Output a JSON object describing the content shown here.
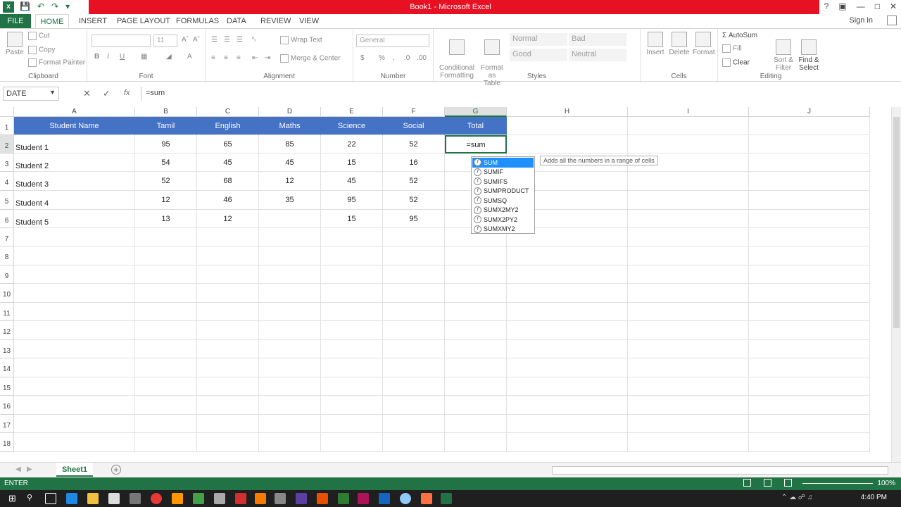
{
  "window": {
    "title": "Book1 -  Microsoft Excel",
    "controls": [
      "?",
      "▣",
      "—",
      "□",
      "✕"
    ]
  },
  "ribbon_tabs": [
    "FILE",
    "HOME",
    "INSERT",
    "PAGE LAYOUT",
    "FORMULAS",
    "DATA",
    "REVIEW",
    "VIEW"
  ],
  "signin": "Sign in",
  "ribbon": {
    "clipboard": {
      "paste": "Paste",
      "cut": "Cut",
      "copy": "Copy",
      "format_painter": "Format Painter",
      "label": "Clipboard"
    },
    "font": {
      "name": "",
      "size": "11",
      "label": "Font",
      "bold": "B",
      "italic": "I",
      "underline": "U",
      "font_color": "A"
    },
    "alignment": {
      "wrap": "Wrap Text",
      "merge": "Merge & Center",
      "label": "Alignment"
    },
    "number": {
      "format": "General",
      "currency": "$",
      "percent": "%",
      "label": "Number"
    },
    "styles": {
      "conditional": "Conditional\nFormatting",
      "format_table": "Format as\nTable",
      "normal": "Normal",
      "bad": "Bad",
      "good": "Good",
      "neutral": "Neutral",
      "label": "Styles"
    },
    "cells": {
      "insert": "Insert",
      "delete": "Delete",
      "format": "Format",
      "label": "Cells"
    },
    "editing": {
      "autosum": "AutoSum",
      "fill": "Fill",
      "clear": "Clear",
      "sort": "Sort &\nFilter",
      "find": "Find &\nSelect",
      "label": "Editing"
    }
  },
  "formula_bar": {
    "name_box": "DATE",
    "cancel": "✕",
    "enter": "✓",
    "fx": "fx",
    "formula": "=sum"
  },
  "columns": [
    "A",
    "B",
    "C",
    "D",
    "E",
    "F",
    "G",
    "H",
    "I",
    "J"
  ],
  "rows": [
    "1",
    "2",
    "3",
    "4",
    "5",
    "6",
    "7",
    "8",
    "9",
    "10",
    "11",
    "12",
    "13",
    "14",
    "15",
    "16",
    "17",
    "18"
  ],
  "table": {
    "headers": [
      "Student Name",
      "Tamil",
      "English",
      "Maths",
      "Science",
      "Social",
      "Total"
    ],
    "data": [
      [
        "Student 1",
        "95",
        "65",
        "85",
        "22",
        "52",
        "=sum"
      ],
      [
        "Student 2",
        "54",
        "45",
        "45",
        "15",
        "16",
        ""
      ],
      [
        "Student 3",
        "52",
        "68",
        "12",
        "45",
        "52",
        ""
      ],
      [
        "Student 4",
        "12",
        "46",
        "35",
        "95",
        "52",
        ""
      ],
      [
        "Student 5",
        "13",
        "12",
        "",
        "15",
        "95",
        ""
      ]
    ]
  },
  "autocomplete": [
    "SUM",
    "SUMIF",
    "SUMIFS",
    "SUMPRODUCT",
    "SUMSQ",
    "SUMX2MY2",
    "SUMX2PY2",
    "SUMXMY2"
  ],
  "tooltip": "Adds all the numbers in a range of cells",
  "sheet_tab": "Sheet1",
  "status": {
    "mode": "ENTER",
    "zoom": "100%"
  },
  "clock": "4:40 PM"
}
